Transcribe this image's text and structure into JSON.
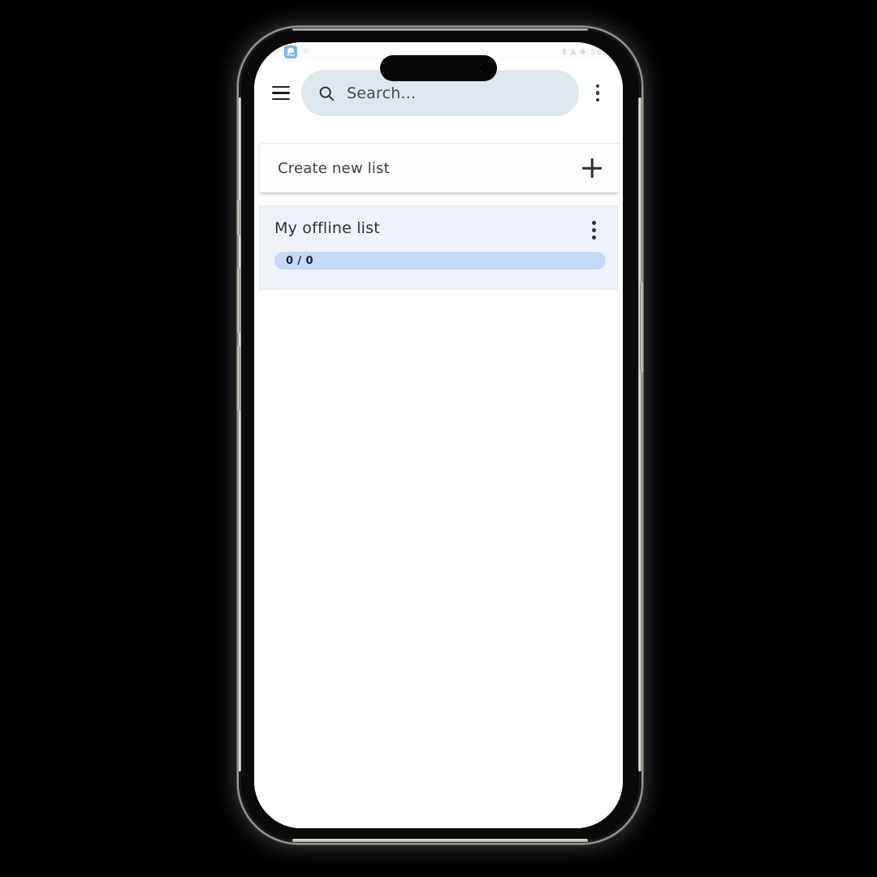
{
  "device": {
    "name": "smartphone-mockup",
    "frame_color": "#0a0a0a",
    "rail_color": "#d6d6cc"
  },
  "status_bar": {
    "left_glyphs": "4G",
    "app_badge": {
      "icon": "app-badge-icon",
      "label": "Plus",
      "color": "#1878c4"
    },
    "extra_glyphs": "⚙",
    "right_glyphs": "▮ ▲ ◆",
    "battery": "58%"
  },
  "top_bar": {
    "menu_icon": "hamburger-menu-icon",
    "search": {
      "icon": "search-icon",
      "value": "",
      "placeholder": "Search..."
    },
    "overflow_icon": "more-vertical-icon"
  },
  "content": {
    "create_list": {
      "label": "Create new list",
      "add_icon": "plus-icon"
    },
    "lists": [
      {
        "title": "My offline list",
        "menu_icon": "more-vertical-icon",
        "progress_label": "0 / 0",
        "completed": 0,
        "total": 0,
        "percent": 0,
        "track_color": "#c3daf8",
        "card_color": "#eef2f8"
      }
    ]
  }
}
